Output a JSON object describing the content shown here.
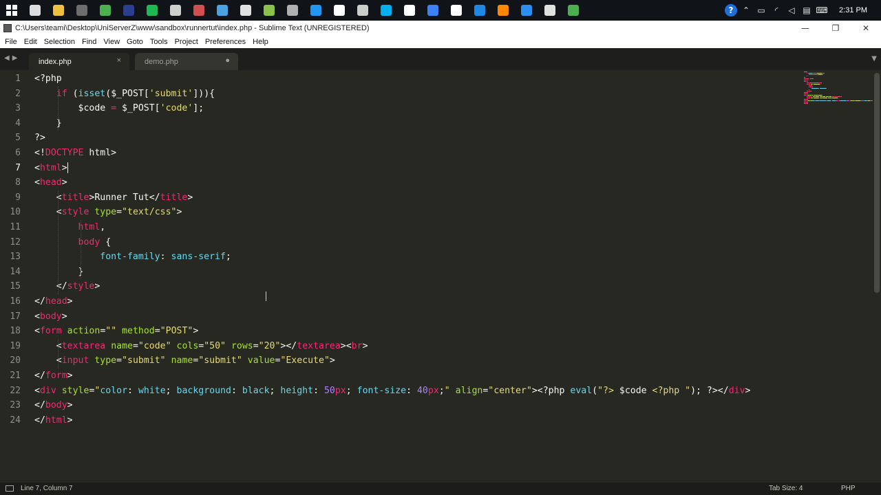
{
  "taskbar": {
    "icons": [
      {
        "name": "task-view-icon",
        "color": "#dddddd"
      },
      {
        "name": "file-explorer-icon",
        "color": "#f0c040"
      },
      {
        "name": "sublime-taskbar-icon",
        "color": "#6d6d6d"
      },
      {
        "name": "chrome-icon",
        "color": "#4caf50"
      },
      {
        "name": "premiere-icon",
        "color": "#2a3f8f"
      },
      {
        "name": "spotify-icon",
        "color": "#1db954"
      },
      {
        "name": "app-icon-7",
        "color": "#cfcfcf"
      },
      {
        "name": "app-icon-8",
        "color": "#d05050"
      },
      {
        "name": "app-icon-9",
        "color": "#4aa3e0"
      },
      {
        "name": "app-icon-10",
        "color": "#e0e0e0"
      },
      {
        "name": "app-icon-11",
        "color": "#8bc34a"
      },
      {
        "name": "app-icon-12",
        "color": "#b0b0b0"
      },
      {
        "name": "app-icon-13",
        "color": "#2196f3"
      },
      {
        "name": "app-icon-14",
        "color": "#ffffff"
      },
      {
        "name": "app-icon-15",
        "color": "#cccccc"
      },
      {
        "name": "skype-icon",
        "color": "#00aff0"
      },
      {
        "name": "app-icon-17",
        "color": "#ffffff"
      },
      {
        "name": "app-icon-18",
        "color": "#3b82f6"
      },
      {
        "name": "uplay-icon",
        "color": "#ffffff"
      },
      {
        "name": "app-icon-20",
        "color": "#1e88e5"
      },
      {
        "name": "vlc-icon",
        "color": "#ff8800"
      },
      {
        "name": "app-icon-22",
        "color": "#2a8ff0"
      },
      {
        "name": "calculator-icon",
        "color": "#e0e0e0"
      },
      {
        "name": "app-icon-24",
        "color": "#4caf50"
      }
    ],
    "clock": "2:31 PM"
  },
  "window": {
    "title": "C:\\Users\\teami\\Desktop\\UniServerZ\\www\\sandbox\\runnertut\\index.php - Sublime Text (UNREGISTERED)",
    "minimize": "—",
    "maximize": "❐",
    "close": "✕"
  },
  "menu": [
    "File",
    "Edit",
    "Selection",
    "Find",
    "View",
    "Goto",
    "Tools",
    "Project",
    "Preferences",
    "Help"
  ],
  "tabs": [
    {
      "label": "index.php",
      "control": "×"
    },
    {
      "label": "demo.php",
      "control": "●"
    }
  ],
  "line_numbers": [
    "1",
    "2",
    "3",
    "4",
    "5",
    "6",
    "7",
    "8",
    "9",
    "10",
    "11",
    "12",
    "13",
    "14",
    "15",
    "16",
    "17",
    "18",
    "19",
    "20",
    "21",
    "22",
    "23",
    "24"
  ],
  "current_line": 7,
  "code_lines": [
    [
      [
        "<?php",
        "t-php"
      ]
    ],
    [
      [
        "    ",
        "t-plain"
      ],
      [
        "if",
        "t-kw"
      ],
      [
        " (",
        "t-plain"
      ],
      [
        "isset",
        "t-fn"
      ],
      [
        "($_POST[",
        "t-plain"
      ],
      [
        "'submit'",
        "t-str"
      ],
      [
        "])){",
        "t-plain"
      ]
    ],
    [
      [
        "        $code ",
        "t-plain"
      ],
      [
        "=",
        "t-kw"
      ],
      [
        " $_POST[",
        "t-plain"
      ],
      [
        "'code'",
        "t-str"
      ],
      [
        "];",
        "t-plain"
      ]
    ],
    [
      [
        "    }",
        "t-plain"
      ]
    ],
    [
      [
        "?>",
        "t-php"
      ]
    ],
    [
      [
        "<!",
        "t-plain"
      ],
      [
        "DOCTYPE",
        "t-tag"
      ],
      [
        " html>",
        "t-plain"
      ]
    ],
    [
      [
        "<",
        "t-plain"
      ],
      [
        "html",
        "t-tag"
      ],
      [
        ">",
        "t-plain"
      ]
    ],
    [
      [
        "<",
        "t-plain"
      ],
      [
        "head",
        "t-tag"
      ],
      [
        ">",
        "t-plain"
      ]
    ],
    [
      [
        "    <",
        "t-plain"
      ],
      [
        "title",
        "t-tag"
      ],
      [
        ">Runner Tut</",
        "t-plain"
      ],
      [
        "title",
        "t-tag"
      ],
      [
        ">",
        "t-plain"
      ]
    ],
    [
      [
        "    <",
        "t-plain"
      ],
      [
        "style",
        "t-tag"
      ],
      [
        " ",
        "t-plain"
      ],
      [
        "type",
        "t-attr"
      ],
      [
        "=",
        "t-plain"
      ],
      [
        "\"text/css\"",
        "t-str"
      ],
      [
        ">",
        "t-plain"
      ]
    ],
    [
      [
        "        ",
        "t-plain"
      ],
      [
        "html",
        "t-tag"
      ],
      [
        ",",
        "t-plain"
      ]
    ],
    [
      [
        "        ",
        "t-plain"
      ],
      [
        "body",
        "t-tag"
      ],
      [
        " {",
        "t-plain"
      ]
    ],
    [
      [
        "            ",
        "t-plain"
      ],
      [
        "font-family",
        "t-fn"
      ],
      [
        ": ",
        "t-plain"
      ],
      [
        "sans-serif",
        "t-fn"
      ],
      [
        ";",
        "t-plain"
      ]
    ],
    [
      [
        "        }",
        "t-plain"
      ]
    ],
    [
      [
        "    </",
        "t-plain"
      ],
      [
        "style",
        "t-tag"
      ],
      [
        ">",
        "t-plain"
      ]
    ],
    [
      [
        "</",
        "t-plain"
      ],
      [
        "head",
        "t-tag"
      ],
      [
        ">",
        "t-plain"
      ]
    ],
    [
      [
        "<",
        "t-plain"
      ],
      [
        "body",
        "t-tag"
      ],
      [
        ">",
        "t-plain"
      ]
    ],
    [
      [
        "<",
        "t-plain"
      ],
      [
        "form",
        "t-tag"
      ],
      [
        " ",
        "t-plain"
      ],
      [
        "action",
        "t-attr"
      ],
      [
        "=",
        "t-plain"
      ],
      [
        "\"\"",
        "t-str"
      ],
      [
        " ",
        "t-plain"
      ],
      [
        "method",
        "t-attr"
      ],
      [
        "=",
        "t-plain"
      ],
      [
        "\"POST\"",
        "t-str"
      ],
      [
        ">",
        "t-plain"
      ]
    ],
    [
      [
        "    <",
        "t-plain"
      ],
      [
        "textarea",
        "t-tag"
      ],
      [
        " ",
        "t-plain"
      ],
      [
        "name",
        "t-attr"
      ],
      [
        "=",
        "t-plain"
      ],
      [
        "\"code\"",
        "t-str"
      ],
      [
        " ",
        "t-plain"
      ],
      [
        "cols",
        "t-attr"
      ],
      [
        "=",
        "t-plain"
      ],
      [
        "\"50\"",
        "t-str"
      ],
      [
        " ",
        "t-plain"
      ],
      [
        "rows",
        "t-attr"
      ],
      [
        "=",
        "t-plain"
      ],
      [
        "\"20\"",
        "t-str"
      ],
      [
        "></",
        "t-plain"
      ],
      [
        "textarea",
        "t-tag"
      ],
      [
        "><",
        "t-plain"
      ],
      [
        "br",
        "t-tag"
      ],
      [
        ">",
        "t-plain"
      ]
    ],
    [
      [
        "    <",
        "t-plain"
      ],
      [
        "input",
        "t-tag"
      ],
      [
        " ",
        "t-plain"
      ],
      [
        "type",
        "t-attr"
      ],
      [
        "=",
        "t-plain"
      ],
      [
        "\"submit\"",
        "t-str"
      ],
      [
        " ",
        "t-plain"
      ],
      [
        "name",
        "t-attr"
      ],
      [
        "=",
        "t-plain"
      ],
      [
        "\"submit\"",
        "t-str"
      ],
      [
        " ",
        "t-plain"
      ],
      [
        "value",
        "t-attr"
      ],
      [
        "=",
        "t-plain"
      ],
      [
        "\"Execute\"",
        "t-str"
      ],
      [
        ">",
        "t-plain"
      ]
    ],
    [
      [
        "</",
        "t-plain"
      ],
      [
        "form",
        "t-tag"
      ],
      [
        ">",
        "t-plain"
      ]
    ],
    [
      [
        "<",
        "t-plain"
      ],
      [
        "div",
        "t-tag"
      ],
      [
        " ",
        "t-plain"
      ],
      [
        "style",
        "t-attr"
      ],
      [
        "=",
        "t-plain"
      ],
      [
        "\"",
        "t-str"
      ],
      [
        "color",
        "t-fn"
      ],
      [
        ": ",
        "t-plain"
      ],
      [
        "white",
        "t-fn"
      ],
      [
        "; ",
        "t-plain"
      ],
      [
        "background",
        "t-fn"
      ],
      [
        ": ",
        "t-plain"
      ],
      [
        "black",
        "t-fn"
      ],
      [
        "; ",
        "t-plain"
      ],
      [
        "height",
        "t-fn"
      ],
      [
        ": ",
        "t-plain"
      ],
      [
        "50",
        "t-num"
      ],
      [
        "px",
        "t-kw"
      ],
      [
        "; ",
        "t-plain"
      ],
      [
        "font-size",
        "t-fn"
      ],
      [
        ": ",
        "t-plain"
      ],
      [
        "40",
        "t-num"
      ],
      [
        "px",
        "t-kw"
      ],
      [
        ";",
        "t-plain"
      ],
      [
        "\"",
        "t-str"
      ],
      [
        " ",
        "t-plain"
      ],
      [
        "align",
        "t-attr"
      ],
      [
        "=",
        "t-plain"
      ],
      [
        "\"center\"",
        "t-str"
      ],
      [
        "><?php ",
        "t-plain"
      ],
      [
        "eval",
        "t-fn"
      ],
      [
        "(",
        "t-plain"
      ],
      [
        "\"?> ",
        "t-str"
      ],
      [
        "$code",
        "t-plain"
      ],
      [
        " <?php \"",
        "t-str"
      ],
      [
        "); ?></",
        "t-plain"
      ],
      [
        "div",
        "t-tag"
      ],
      [
        ">",
        "t-plain"
      ]
    ],
    [
      [
        "</",
        "t-plain"
      ],
      [
        "body",
        "t-tag"
      ],
      [
        ">",
        "t-plain"
      ]
    ],
    [
      [
        "</",
        "t-plain"
      ],
      [
        "html",
        "t-tag"
      ],
      [
        ">",
        "t-plain"
      ]
    ]
  ],
  "status": {
    "position": "Line 7, Column 7",
    "tab_size": "Tab Size: 4",
    "syntax": "PHP"
  },
  "colors": {
    "editor_bg": "#272822",
    "tag": "#f92672",
    "attr": "#a6e22e",
    "string": "#e6db74",
    "func": "#66d9ef",
    "number": "#ae81ff"
  }
}
